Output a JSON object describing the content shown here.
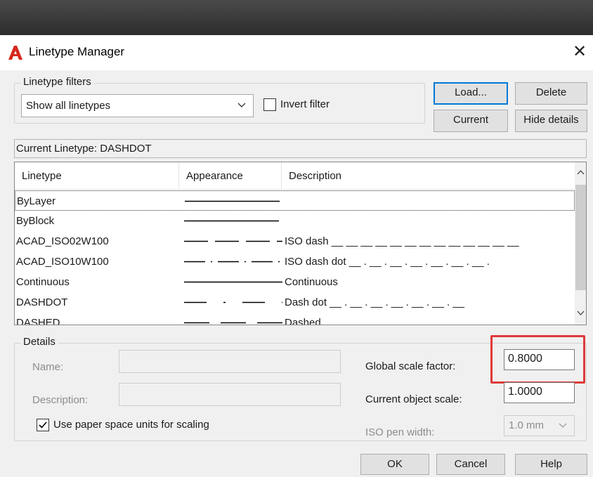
{
  "window": {
    "title": "Linetype Manager",
    "close_glyph": "✕"
  },
  "filters": {
    "legend": "Linetype filters",
    "selected": "Show all linetypes",
    "invert_label": "Invert filter",
    "invert_checked": false
  },
  "buttons": {
    "load": "Load...",
    "delete": "Delete",
    "current": "Current",
    "hide_details": "Hide details",
    "ok": "OK",
    "cancel": "Cancel",
    "help": "Help"
  },
  "current_linetype": {
    "label": "Current Linetype:",
    "value": "DASHDOT"
  },
  "list": {
    "columns": [
      "Linetype",
      "Appearance",
      "Description"
    ],
    "rows": [
      {
        "name": "ByLayer",
        "appearance": "solid",
        "description": "",
        "desc_pattern": ""
      },
      {
        "name": "ByBlock",
        "appearance": "solid",
        "description": "",
        "desc_pattern": ""
      },
      {
        "name": "ACAD_ISO02W100",
        "appearance": "dash",
        "description": "ISO dash",
        "desc_pattern": "__ __ __ __ __ __ __ __ __ __ __ __ __"
      },
      {
        "name": "ACAD_ISO10W100",
        "appearance": "dashdot",
        "description": "ISO dash dot",
        "desc_pattern": "__ . __ . __ . __ . __ . __ . __ ."
      },
      {
        "name": "Continuous",
        "appearance": "solid",
        "description": "Continuous",
        "desc_pattern": ""
      },
      {
        "name": "DASHDOT",
        "appearance": "dashdot",
        "description": "Dash dot",
        "desc_pattern": "__ . __ . __ . __ . __ . __ . __"
      },
      {
        "name": "DASHED",
        "appearance": "dashed",
        "description": "Dashed",
        "desc_pattern": ""
      }
    ],
    "selected_index": 0
  },
  "details": {
    "legend": "Details",
    "name_label": "Name:",
    "name_value": "",
    "description_label": "Description:",
    "description_value": "",
    "paper_space_label": "Use paper space units for scaling",
    "paper_space_checked": true,
    "global_scale_label": "Global scale factor:",
    "global_scale_value": "0.8000",
    "current_scale_label": "Current object scale:",
    "current_scale_value": "1.0000",
    "iso_pen_label": "ISO pen width:",
    "iso_pen_value": "1.0 mm"
  },
  "colors": {
    "highlight": "#e03a3a",
    "app_icon": "#d6281e",
    "focus_border": "#0078d7"
  }
}
